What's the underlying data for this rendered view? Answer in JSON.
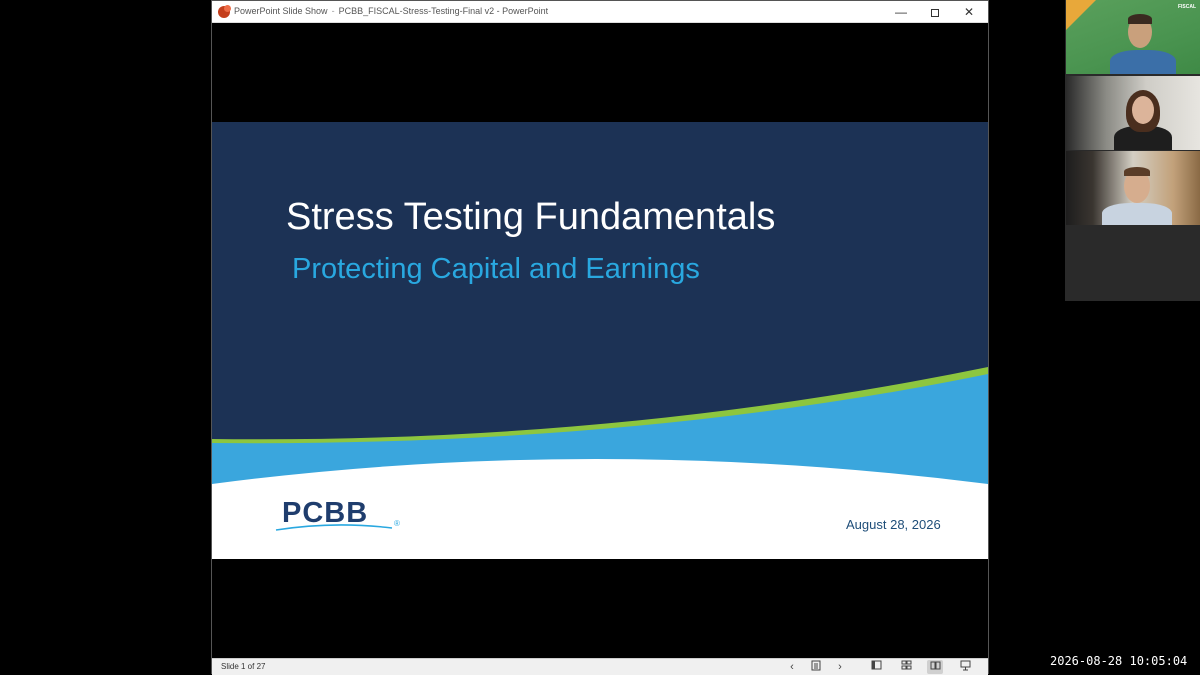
{
  "window": {
    "app_name": "PowerPoint Slide Show",
    "separator": "-",
    "document_title": "PCBB_FISCAL-Stress-Testing-Final v2 - PowerPoint",
    "minimize_glyph": "—",
    "close_glyph": "✕"
  },
  "slide": {
    "title": "Stress Testing Fundamentals",
    "subtitle": "Protecting Capital and Earnings",
    "logo_text": "PCBB",
    "logo_reg": "®",
    "date": "August 28, 2026",
    "colors": {
      "background": "#1c3255",
      "accent_green": "#8dc63f",
      "accent_blue": "#3aa6dd",
      "subtitle": "#29a8e0"
    }
  },
  "statusbar": {
    "slide_counter": "Slide 1 of 27",
    "prev_glyph": "‹",
    "next_glyph": "›"
  },
  "video": {
    "tile1_logo": "FISCAL"
  },
  "timestamp": "2026-08-28  10:05:04"
}
